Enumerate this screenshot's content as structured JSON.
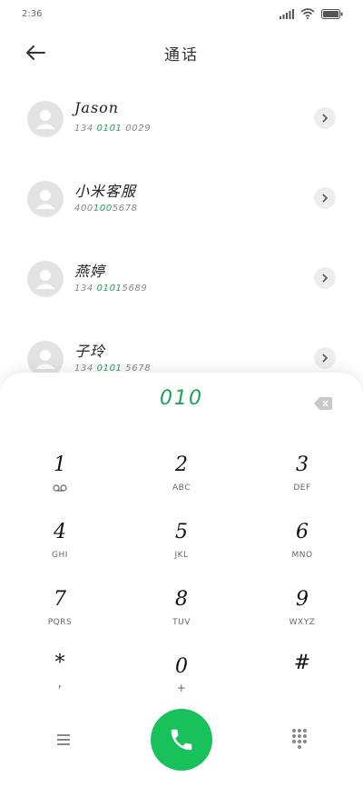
{
  "status": {
    "time": "2:36"
  },
  "header": {
    "title": "通话"
  },
  "contacts": [
    {
      "name": "Jason",
      "num_pre": "134 ",
      "num_hl": "0101",
      "num_post": " 0029"
    },
    {
      "name": "小米客服",
      "num_pre": "400",
      "num_hl": "100",
      "num_post": "5678"
    },
    {
      "name": "燕婷",
      "num_pre": "134 ",
      "num_hl": "0101",
      "num_post": "5689"
    },
    {
      "name": "子玲",
      "num_pre": "134 ",
      "num_hl": "0101",
      "num_post": " 5678"
    }
  ],
  "dialpad": {
    "typed": "010",
    "keys": [
      {
        "digit": "1",
        "letters": ""
      },
      {
        "digit": "2",
        "letters": "ABC"
      },
      {
        "digit": "3",
        "letters": "DEF"
      },
      {
        "digit": "4",
        "letters": "GHI"
      },
      {
        "digit": "5",
        "letters": "JKL"
      },
      {
        "digit": "6",
        "letters": "MNO"
      },
      {
        "digit": "7",
        "letters": "PQRS"
      },
      {
        "digit": "8",
        "letters": "TUV"
      },
      {
        "digit": "9",
        "letters": "WXYZ"
      },
      {
        "digit": "*",
        "letters": ","
      },
      {
        "digit": "0",
        "letters": "+"
      },
      {
        "digit": "#",
        "letters": ""
      }
    ]
  },
  "colors": {
    "accent": "#1aa35a",
    "call": "#19c15b"
  },
  "icons": {
    "voicemail": "voicemail-icon",
    "back": "back-arrow-icon",
    "call": "phone-icon",
    "menu": "menu-icon",
    "keypad": "keypad-icon",
    "backspace": "backspace-icon",
    "chevron": "chevron-right-icon"
  }
}
